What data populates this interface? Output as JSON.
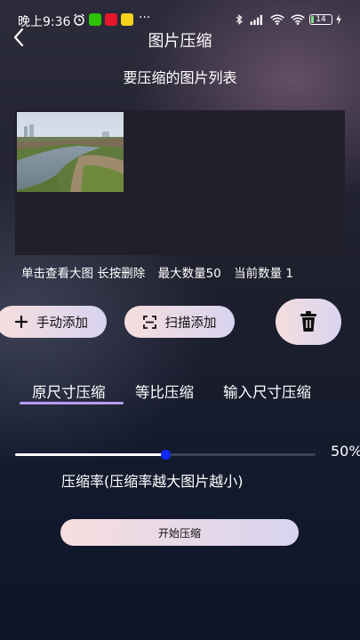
{
  "status_bar": {
    "time": "晚上9:36",
    "battery": "14",
    "app_icons": [
      "alarm-icon",
      "wechat-icon",
      "weibo-icon",
      "app-icon",
      "more-icon"
    ],
    "right_icons": [
      "bluetooth-icon",
      "signal-icon",
      "wifi-icon",
      "battery-icon",
      "charging-icon"
    ]
  },
  "header": {
    "title": "图片压缩",
    "subtitle": "要压缩的图片列表"
  },
  "image_list": {
    "hint_click": "单击查看大图 长按删除",
    "max_count": "最大数量50",
    "current_count": "当前数量 1",
    "images": [
      {
        "thumbnail": "river-landscape-photo"
      }
    ]
  },
  "buttons": {
    "manual_add": "手动添加",
    "scan_add": "扫描添加",
    "delete_icon": "trash-icon"
  },
  "tabs": [
    {
      "label": "原尺寸压缩",
      "selected": true
    },
    {
      "label": "等比压缩",
      "selected": false
    },
    {
      "label": "输入尺寸压缩",
      "selected": false
    }
  ],
  "compression": {
    "rate_value": 0.5,
    "rate_text": "50%",
    "label": "压缩率(压缩率越大图片越小)"
  },
  "start_button": "开始压缩",
  "colors": {
    "accent_underline": "#b59cf2",
    "slider_thumb": "#1028ff",
    "button_gradient_start": "#f6dede",
    "button_gradient_end": "#d8d4ef"
  }
}
